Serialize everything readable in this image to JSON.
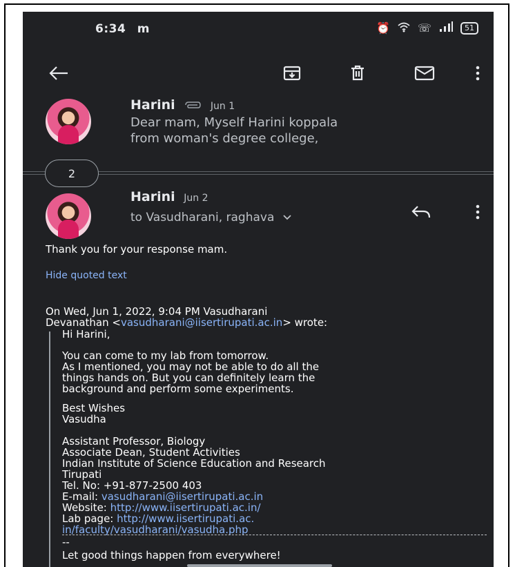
{
  "status": {
    "time": "6:34",
    "app_letter": "m",
    "battery": "51"
  },
  "toolbar": {
    "icons": [
      "back-arrow-icon",
      "archive-icon",
      "delete-icon",
      "mark-unread-icon",
      "more-vert-icon"
    ]
  },
  "message1": {
    "sender": "Harini",
    "date": "Jun 1",
    "snippet_line1": "Dear mam, Myself Harini koppala",
    "snippet_line2": "from woman's degree college,"
  },
  "collapsed": {
    "count": "2"
  },
  "message2": {
    "sender": "Harini",
    "date": "Jun 2",
    "recipients": "to Vasudharani, raghava",
    "body": "Thank you for your response mam.",
    "hide_quoted": "Hide quoted text",
    "quote_header_line1": "On Wed, Jun 1, 2022, 9:04 PM Vasudharani",
    "quote_header_name": "Devanathan <",
    "quote_header_email": "vasudharani@iisertirupati.ac.in",
    "quote_header_end": "> wrote:",
    "greeting": "Hi Harini,",
    "para1_l1": "You can come to my lab from tomorrow.",
    "para1_l2": "As I mentioned, you may not be able to do all the",
    "para1_l3": "things hands on. But you can definitely learn the",
    "para1_l4": "background and perform some experiments.",
    "wishes": "Best Wishes",
    "name": "Vasudha",
    "sig_l1": "Assistant Professor, Biology",
    "sig_l2": "Associate Dean, Student Activities",
    "sig_l3": "Indian Institute of Science Education and Research",
    "sig_l4": "Tirupati",
    "sig_tel": "Tel. No: +91-877-2500 403",
    "sig_email_label": "E-mail: ",
    "sig_email": "vasudharani@iisertirupati.ac.in",
    "sig_web_label": "Website: ",
    "sig_web": "http://www.iisertirupati.ac.in/",
    "sig_lab_label": "Lab page: ",
    "sig_lab_l1": "http://www.iisertirupati.ac.",
    "sig_lab_l2": "in/faculty/vasudharani/vasudha.php",
    "dash_tail": "--",
    "motto": "Let good things happen from everywhere!"
  }
}
